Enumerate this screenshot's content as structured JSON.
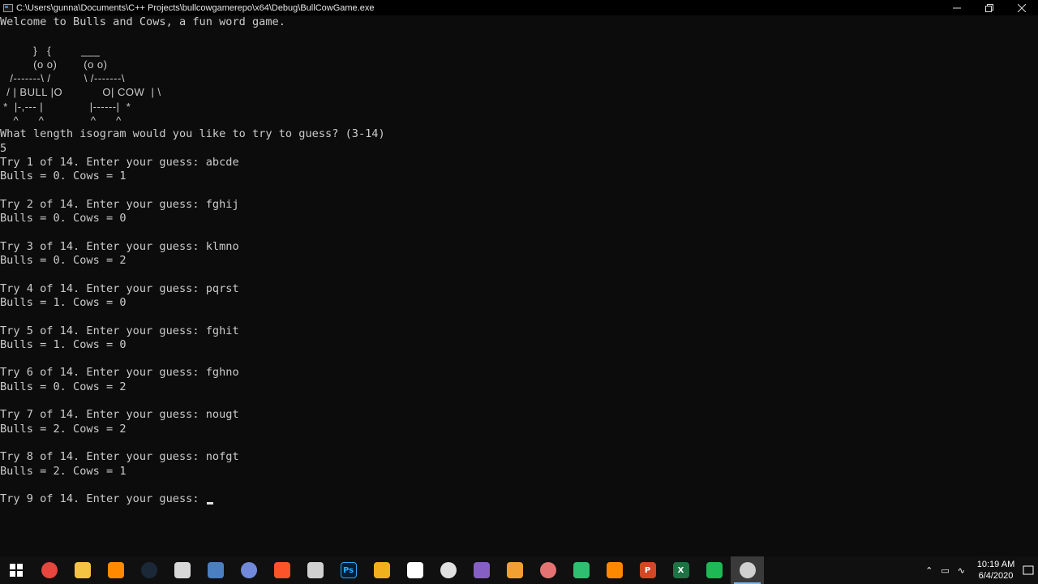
{
  "window": {
    "title": "C:\\Users\\gunna\\Documents\\C++ Projects\\bullcowgamerepo\\x64\\Debug\\BullCowGame.exe"
  },
  "console": {
    "lines": [
      "Welcome to Bulls and Cows, a fun word game.",
      "",
      "          }   {         ___",
      "          (o o)        (o o)",
      "   /-------\\ /          \\ /-------\\",
      "  / | BULL |O            O| COW  | \\",
      " *  |-,--- |              |------|  *",
      "    ^      ^              ^      ^",
      "What length isogram would you like to try to guess? (3-14)",
      "5",
      "Try 1 of 14. Enter your guess: abcde",
      "Bulls = 0. Cows = 1",
      "",
      "Try 2 of 14. Enter your guess: fghij",
      "Bulls = 0. Cows = 0",
      "",
      "Try 3 of 14. Enter your guess: klmno",
      "Bulls = 0. Cows = 2",
      "",
      "Try 4 of 14. Enter your guess: pqrst",
      "Bulls = 1. Cows = 0",
      "",
      "Try 5 of 14. Enter your guess: fghit",
      "Bulls = 1. Cows = 0",
      "",
      "Try 6 of 14. Enter your guess: fghno",
      "Bulls = 0. Cows = 2",
      "",
      "Try 7 of 14. Enter your guess: nougt",
      "Bulls = 2. Cows = 2",
      "",
      "Try 8 of 14. Enter your guess: nofgt",
      "Bulls = 2. Cows = 1",
      "",
      "Try 9 of 14. Enter your guess: "
    ]
  },
  "taskbar": {
    "icons": [
      {
        "name": "chrome-icon",
        "color": "#e8453c"
      },
      {
        "name": "file-explorer-icon",
        "color": "#f5c342"
      },
      {
        "name": "search-icon",
        "color": "#ff8a00"
      },
      {
        "name": "steam-icon",
        "color": "#1b2838"
      },
      {
        "name": "itunes-icon",
        "color": "#d8d8d8"
      },
      {
        "name": "paint-icon",
        "color": "#4a7fc1"
      },
      {
        "name": "discord-icon",
        "color": "#7289da"
      },
      {
        "name": "brave-icon",
        "color": "#fb542b"
      },
      {
        "name": "obs-icon",
        "color": "#d0d0d0"
      },
      {
        "name": "photoshop-icon",
        "color": "#31a8ff",
        "label": "Ps"
      },
      {
        "name": "printer-icon",
        "color": "#f2b01e"
      },
      {
        "name": "git-icon",
        "color": "#ffffff"
      },
      {
        "name": "unity-icon",
        "color": "#e0e0e0"
      },
      {
        "name": "visual-studio-icon",
        "color": "#865fc5"
      },
      {
        "name": "sublime-icon",
        "color": "#f0a030"
      },
      {
        "name": "game-icon",
        "color": "#e57373"
      },
      {
        "name": "flag-icon",
        "color": "#2fbf71"
      },
      {
        "name": "vlc-icon",
        "color": "#ff8800"
      },
      {
        "name": "powerpoint-icon",
        "color": "#d24726",
        "label": "P"
      },
      {
        "name": "excel-icon",
        "color": "#1f7244",
        "label": "X"
      },
      {
        "name": "sync-icon",
        "color": "#1db954"
      },
      {
        "name": "console-icon",
        "color": "#d0d0d0",
        "active": true
      }
    ],
    "clock": {
      "time": "10:19 AM",
      "date": "6/4/2020"
    }
  }
}
